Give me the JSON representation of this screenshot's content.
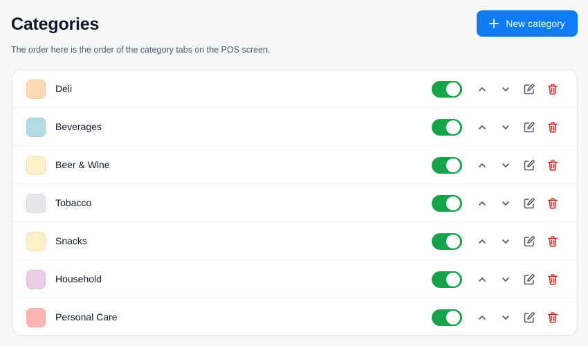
{
  "header": {
    "title": "Categories",
    "subtitle": "The order here is the order of the category tabs on the POS screen.",
    "new_button_label": "New category",
    "new_button_icon": "plus-icon",
    "accent_color": "#0d7cf2"
  },
  "categories": [
    {
      "name": "Deli",
      "color": "#ffd9b3",
      "enabled": true
    },
    {
      "name": "Beverages",
      "color": "#b3dbe6",
      "enabled": true
    },
    {
      "name": "Beer & Wine",
      "color": "#fff0c7",
      "enabled": true
    },
    {
      "name": "Tobacco",
      "color": "#e5e7ea",
      "enabled": true
    },
    {
      "name": "Snacks",
      "color": "#fff0c7",
      "enabled": true
    },
    {
      "name": "Household",
      "color": "#ebcde8",
      "enabled": true
    },
    {
      "name": "Personal Care",
      "color": "#ffb3b3",
      "enabled": true
    }
  ],
  "row_actions": {
    "up_icon": "chevron-up-icon",
    "down_icon": "chevron-down-icon",
    "edit_icon": "edit-icon",
    "delete_icon": "trash-icon",
    "toggle_on_color": "#16a34a",
    "delete_color": "#dc2626"
  }
}
